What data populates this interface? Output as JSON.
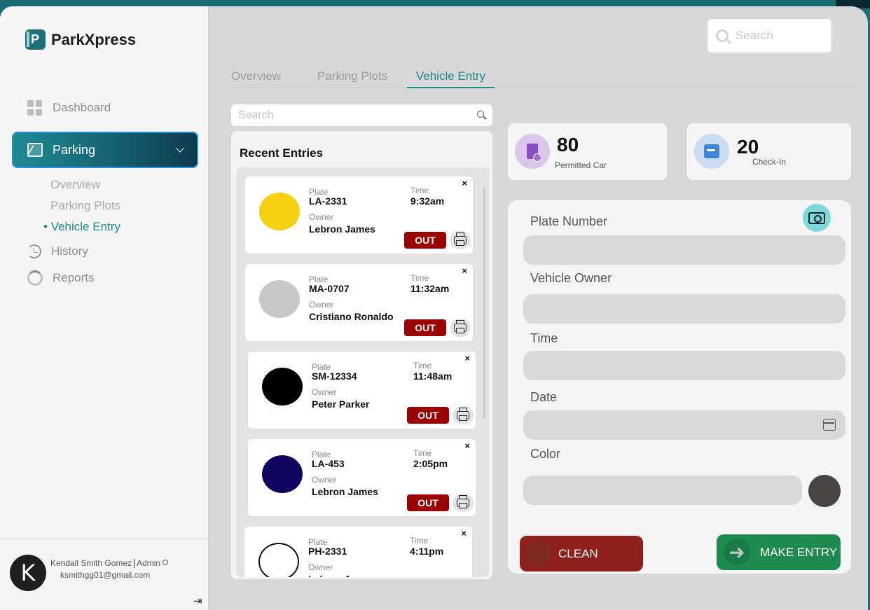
{
  "brand": {
    "name": "ParkXpress",
    "logo_letter": "P"
  },
  "sidebar": {
    "dashboard": "Dashboard",
    "parking": "Parking",
    "sub_items": [
      "Overview",
      "Parking Plots",
      "Vehicle Entry"
    ],
    "active_sub": "Vehicle Entry",
    "history": "History",
    "reports": "Reports"
  },
  "user": {
    "initial": "K",
    "name": "Kendall Smith Gomez",
    "role": "Admin",
    "email": "ksmithgg01@gmail.com"
  },
  "header": {
    "search_placeholder": "Search"
  },
  "tabs": [
    "Overview",
    "Parking Plots",
    "Vehicle Entry"
  ],
  "entries_search_placeholder": "Search",
  "recent": {
    "title": "Recent Entries",
    "labels": {
      "plate": "Plate",
      "owner": "Owner",
      "time": "Time",
      "out": "OUT",
      "close": "×"
    },
    "items": [
      {
        "plate": "LA-2331",
        "owner": "Lebron James",
        "time": "9:32am",
        "color": "#f5d10f"
      },
      {
        "plate": "MA-0707",
        "owner": "Cristiano Ronaldo",
        "time": "11:32am",
        "color": "#c8c8c8"
      },
      {
        "plate": "SM-12334",
        "owner": "Peter Parker",
        "time": "11:48am",
        "color": "#000000"
      },
      {
        "plate": "LA-453",
        "owner": "Lebron James",
        "time": "2:05pm",
        "color": "#0f0560"
      },
      {
        "plate": "PH-2331",
        "owner": "Lebron James",
        "time": "4:11pm",
        "color": "#ffffff"
      }
    ]
  },
  "stats": [
    {
      "value": "80",
      "label": "Permitted Car",
      "icon": "permit-doc-icon"
    },
    {
      "value": "20",
      "label": "Check-In",
      "icon": "calendar-checkin-icon"
    }
  ],
  "form": {
    "plate_label": "Plate Number",
    "owner_label": "Vehicle Owner",
    "time_label": "Time",
    "date_label": "Date",
    "color_label": "Color",
    "selected_color": "#4a4444",
    "clean_label": "CLEAN",
    "make_label": "MAKE ENTRY"
  }
}
